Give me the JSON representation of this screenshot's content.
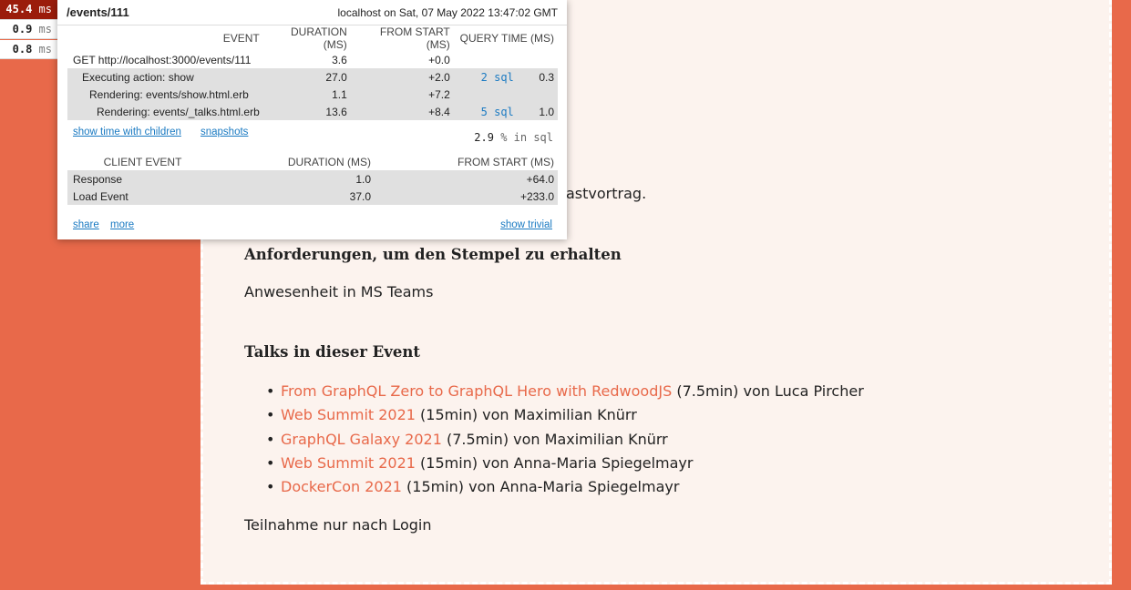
{
  "profiler": {
    "badges": [
      {
        "value": "45.4",
        "unit": "ms"
      },
      {
        "value": "0.9",
        "unit": "ms"
      },
      {
        "value": "0.8",
        "unit": "ms"
      }
    ],
    "title": "/events/111",
    "date": "localhost on Sat, 07 May 2022 13:47:02 GMT",
    "server_headers": [
      "EVENT",
      "DURATION (MS)",
      "FROM START (MS)",
      "QUERY TIME (MS)"
    ],
    "server_rows": [
      {
        "name": "GET http://localhost:3000/events/111",
        "duration": "3.6",
        "from_start": "+0.0",
        "sql": "",
        "query_time": ""
      },
      {
        "name": "Executing action: show",
        "duration": "27.0",
        "from_start": "+2.0",
        "sql": "2 sql",
        "query_time": "0.3"
      },
      {
        "name": "Rendering: events/show.html.erb",
        "duration": "1.1",
        "from_start": "+7.2",
        "sql": "",
        "query_time": ""
      },
      {
        "name": "Rendering: events/_talks.html.erb",
        "duration": "13.6",
        "from_start": "+8.4",
        "sql": "5 sql",
        "query_time": "1.0"
      }
    ],
    "show_children_label": "show time with children",
    "snapshots_label": "snapshots",
    "sql_percent": "2.9",
    "sql_percent_suffix": "% in sql",
    "client_headers": [
      "CLIENT EVENT",
      "DURATION (MS)",
      "FROM START (MS)"
    ],
    "client_rows": [
      {
        "name": "Response",
        "duration": "1.0",
        "from_start": "+64.0"
      },
      {
        "name": "Load Event",
        "duration": "37.0",
        "from_start": "+233.0"
      }
    ],
    "share_label": "share",
    "more_label": "more",
    "show_trivial_label": "show trivial"
  },
  "page": {
    "partial_text": "astvortrag.",
    "requirements_heading": "Anforderungen, um den Stempel zu erhalten",
    "requirements_text": "Anwesenheit in MS Teams",
    "talks_heading": "Talks in dieser Event",
    "talks": [
      {
        "title": "From GraphQL Zero to GraphQL Hero with RedwoodJS",
        "meta": " (7.5min) von Luca Pircher"
      },
      {
        "title": "Web Summit 2021",
        "meta": " (15min) von Maximilian Knürr"
      },
      {
        "title": "GraphQL Galaxy 2021",
        "meta": " (7.5min) von Maximilian Knürr"
      },
      {
        "title": "Web Summit 2021",
        "meta": " (15min) von Anna-Maria Spiegelmayr"
      },
      {
        "title": "DockerCon 2021",
        "meta": " (15min) von Anna-Maria Spiegelmayr"
      }
    ],
    "login_note": "Teilnahme nur nach Login"
  },
  "colors": {
    "background": "#e8694a",
    "card": "#fcf3ee",
    "link": "#e8694a",
    "profiler_active": "#9b1c0b",
    "profiler_link": "#1a7ac2"
  }
}
